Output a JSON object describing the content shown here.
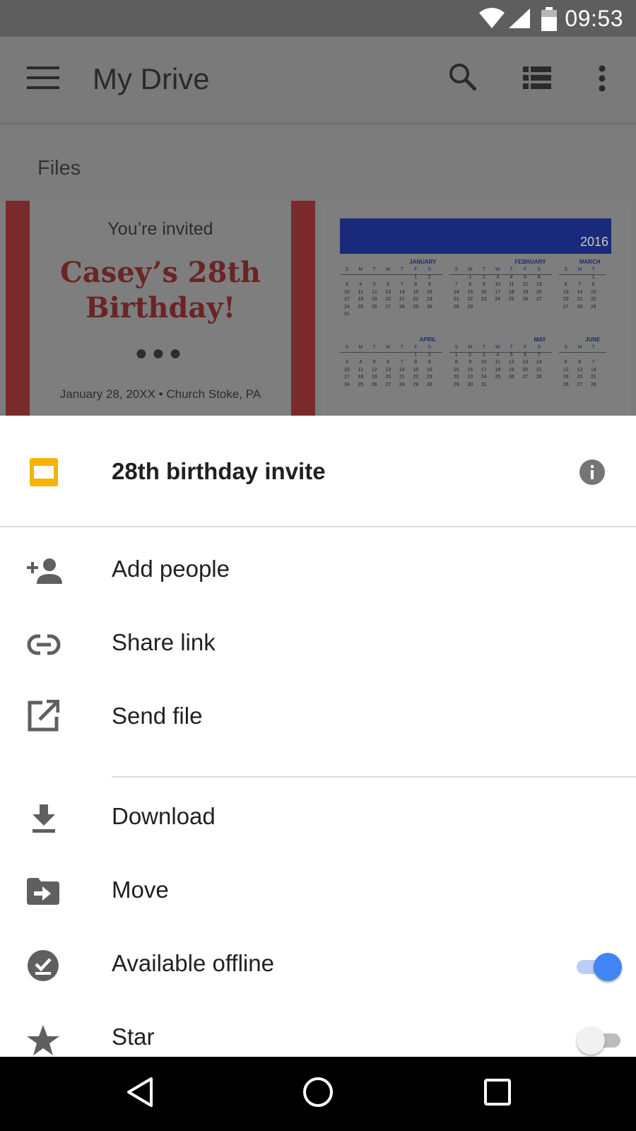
{
  "status_bar": {
    "time": "09:53",
    "icons": [
      "wifi-icon",
      "cell-signal-icon",
      "battery-icon"
    ]
  },
  "app_bar": {
    "menu_icon": "hamburger-menu-icon",
    "title": "My Drive",
    "actions": [
      "search-icon",
      "list-view-icon",
      "more-vert-icon"
    ]
  },
  "content": {
    "section_label": "Files",
    "invite_thumbnail": {
      "subtitle": "You’re invited",
      "title_line1": "Casey’s 28th",
      "title_line2": "Birthday!",
      "dots": "●●●",
      "footer": "January 28, 20XX • Church Stoke, PA"
    },
    "calendar_thumbnail": {
      "year": "2016",
      "weekday_letters": [
        "S",
        "M",
        "T",
        "W",
        "T",
        "F",
        "S"
      ],
      "months": [
        {
          "name": "JANUARY",
          "rows": [
            [
              "",
              "",
              "",
              "",
              "",
              "1",
              "2"
            ],
            [
              "3",
              "4",
              "5",
              "6",
              "7",
              "8",
              "9"
            ],
            [
              "10",
              "11",
              "12",
              "13",
              "14",
              "15",
              "16"
            ],
            [
              "17",
              "18",
              "19",
              "20",
              "21",
              "22",
              "23"
            ],
            [
              "24",
              "25",
              "26",
              "27",
              "28",
              "29",
              "30"
            ],
            [
              "31",
              "",
              "",
              "",
              "",
              "",
              ""
            ]
          ]
        },
        {
          "name": "FEBRUARY",
          "rows": [
            [
              "",
              "1",
              "2",
              "3",
              "4",
              "5",
              "6"
            ],
            [
              "7",
              "8",
              "9",
              "10",
              "11",
              "12",
              "13"
            ],
            [
              "14",
              "15",
              "16",
              "17",
              "18",
              "19",
              "20"
            ],
            [
              "21",
              "22",
              "23",
              "24",
              "25",
              "26",
              "27"
            ],
            [
              "28",
              "29",
              "",
              "",
              "",
              "",
              ""
            ]
          ]
        },
        {
          "name": "MARCH",
          "rows": [
            [
              "",
              "",
              "1"
            ],
            [
              "6",
              "7",
              "8"
            ],
            [
              "13",
              "14",
              "15"
            ],
            [
              "20",
              "21",
              "22"
            ],
            [
              "27",
              "28",
              "29"
            ]
          ]
        },
        {
          "name": "APRIL",
          "rows": [
            [
              "",
              "",
              "",
              "",
              "",
              "1",
              "2"
            ],
            [
              "3",
              "4",
              "5",
              "6",
              "7",
              "8",
              "9"
            ],
            [
              "10",
              "11",
              "12",
              "13",
              "14",
              "15",
              "16"
            ],
            [
              "17",
              "18",
              "19",
              "20",
              "21",
              "22",
              "23"
            ],
            [
              "24",
              "25",
              "26",
              "27",
              "28",
              "29",
              "30"
            ]
          ]
        },
        {
          "name": "MAY",
          "rows": [
            [
              "1",
              "2",
              "3",
              "4",
              "5",
              "6",
              "7"
            ],
            [
              "8",
              "9",
              "10",
              "11",
              "12",
              "13",
              "14"
            ],
            [
              "15",
              "16",
              "17",
              "18",
              "19",
              "20",
              "21"
            ],
            [
              "22",
              "23",
              "24",
              "25",
              "26",
              "27",
              "28"
            ],
            [
              "29",
              "30",
              "31",
              "",
              "",
              "",
              ""
            ]
          ]
        },
        {
          "name": "JUNE",
          "rows": [
            [
              "",
              "",
              ""
            ],
            [
              "5",
              "6",
              "7"
            ],
            [
              "12",
              "13",
              "14"
            ],
            [
              "19",
              "20",
              "21"
            ],
            [
              "26",
              "27",
              "28"
            ]
          ]
        }
      ]
    }
  },
  "sheet": {
    "file_icon": "slides-file-icon",
    "file_name": "28th birthday invite",
    "info_icon": "info-icon",
    "items": [
      {
        "label": "Add people",
        "icon": "add-person-icon"
      },
      {
        "label": "Share link",
        "icon": "link-icon"
      },
      {
        "label": "Send file",
        "icon": "open-external-icon"
      },
      {
        "label": "Download",
        "icon": "download-icon"
      },
      {
        "label": "Move",
        "icon": "move-to-folder-icon"
      },
      {
        "label": "Available offline",
        "icon": "offline-check-icon",
        "toggle": true
      },
      {
        "label": "Star",
        "icon": "star-icon",
        "toggle": false
      }
    ]
  },
  "nav_bar": {
    "buttons": [
      "back-icon",
      "home-icon",
      "recents-icon"
    ]
  },
  "colors": {
    "status_bar": "#5e5e5e",
    "app_bar_scrim": "#7a7a7a",
    "file_icon": "#f4b400",
    "toggle_on_knob": "#4285f4",
    "toggle_on_track": "#b9cff7",
    "toggle_off_knob": "#f1f1f1",
    "toggle_off_track": "#bdbdbd",
    "icon_grey": "#5f5f5f"
  }
}
